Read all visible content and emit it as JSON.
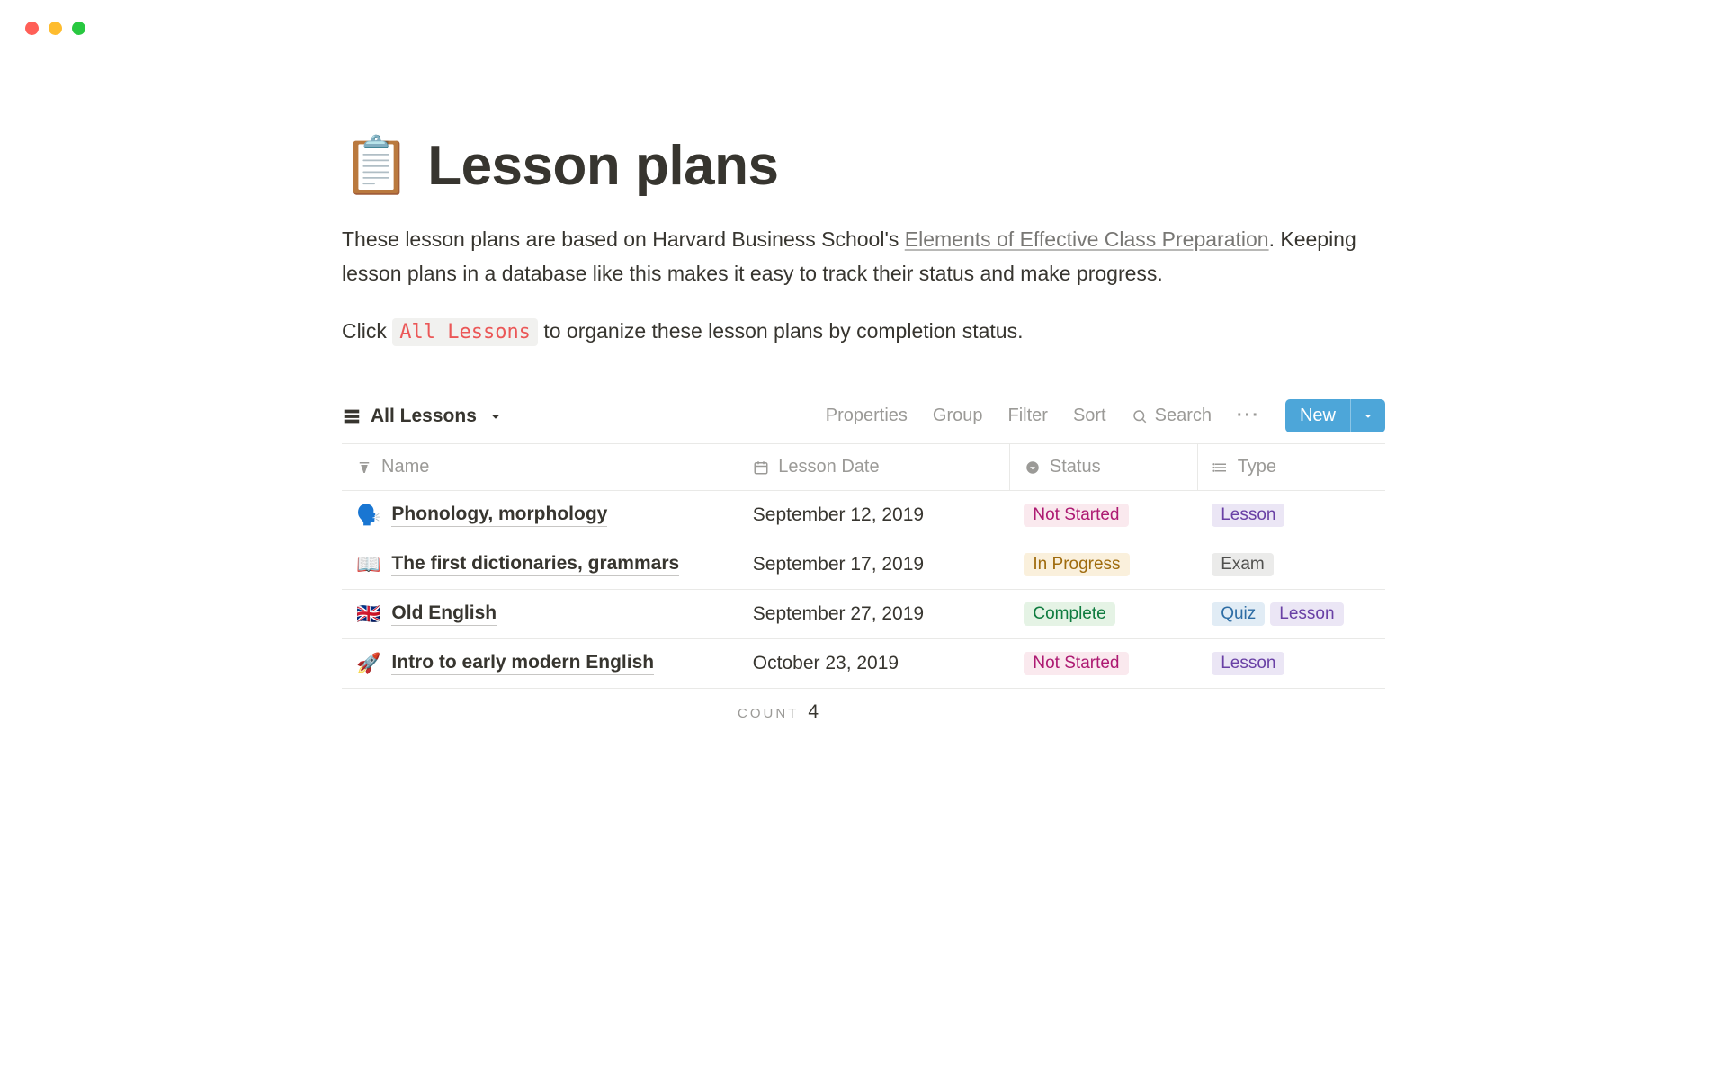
{
  "header": {
    "icon": "📋",
    "title": "Lesson plans"
  },
  "description": {
    "prefix": "These lesson plans are based on Harvard Business School's ",
    "link_text": "Elements of Effective Class Preparation",
    "suffix": ". Keeping lesson plans in a database like this makes it easy to track their status and make progress."
  },
  "instruction": {
    "prefix": "Click ",
    "chip": "All Lessons",
    "suffix": " to organize these lesson plans by completion status."
  },
  "db_toolbar": {
    "view_label": "All Lessons",
    "properties": "Properties",
    "group": "Group",
    "filter": "Filter",
    "sort": "Sort",
    "search": "Search",
    "new": "New"
  },
  "columns": {
    "name": "Name",
    "date": "Lesson Date",
    "status": "Status",
    "type": "Type"
  },
  "rows": [
    {
      "emoji": "🗣️",
      "title": "Phonology, morphology",
      "date": "September 12, 2019",
      "status": {
        "label": "Not Started",
        "class": "tag-not-started"
      },
      "types": [
        {
          "label": "Lesson",
          "class": "tag-lesson"
        }
      ]
    },
    {
      "emoji": "📖",
      "title": "The first dictionaries, grammars",
      "date": "September 17, 2019",
      "status": {
        "label": "In Progress",
        "class": "tag-in-progress"
      },
      "types": [
        {
          "label": "Exam",
          "class": "tag-exam"
        }
      ]
    },
    {
      "emoji": "🇬🇧",
      "title": "Old English",
      "date": "September 27, 2019",
      "status": {
        "label": "Complete",
        "class": "tag-complete"
      },
      "types": [
        {
          "label": "Quiz",
          "class": "tag-quiz"
        },
        {
          "label": "Lesson",
          "class": "tag-lesson"
        }
      ]
    },
    {
      "emoji": "🚀",
      "title": "Intro to early modern English",
      "date": "October 23, 2019",
      "status": {
        "label": "Not Started",
        "class": "tag-not-started"
      },
      "types": [
        {
          "label": "Lesson",
          "class": "tag-lesson"
        }
      ]
    }
  ],
  "footer": {
    "count_label": "count",
    "count_value": "4"
  }
}
